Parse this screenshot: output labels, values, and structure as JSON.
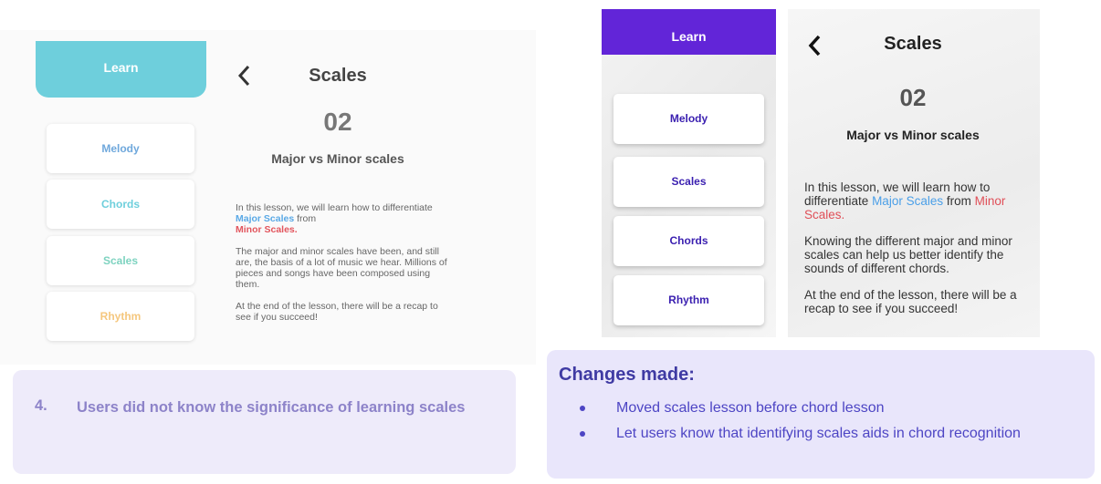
{
  "old_design": {
    "sidebar": {
      "learn_label": "Learn",
      "items": [
        {
          "label": "Melody",
          "color": "#6fa8dc"
        },
        {
          "label": "Chords",
          "color": "#6ecfdc"
        },
        {
          "label": "Scales",
          "color": "#7ed3c0"
        },
        {
          "label": "Rhythm",
          "color": "#f5c77e"
        }
      ]
    },
    "lesson": {
      "title": "Scales",
      "number": "02",
      "subtitle": "Major vs Minor scales",
      "intro_prefix": "In this lesson, we will learn how to differentiate",
      "major_scales": "Major Scales",
      "from": " from",
      "minor_scales": "Minor Scales",
      "period": ".",
      "paragraph2": "The major and minor scales have been, and still are, the basis of a lot of music we hear. Millions of pieces and songs have been composed using them.",
      "paragraph3": "At the end of the lesson, there will be a recap to see if you succeed!"
    },
    "issue": {
      "number": "4.",
      "text": "Users did not know the significance of learning scales"
    }
  },
  "new_design": {
    "sidebar": {
      "learn_label": "Learn",
      "items": [
        {
          "label": "Melody"
        },
        {
          "label": "Scales"
        },
        {
          "label": "Chords"
        },
        {
          "label": "Rhythm"
        }
      ]
    },
    "lesson": {
      "title": "Scales",
      "number": "02",
      "subtitle": "Major vs Minor scales",
      "intro_prefix": "In this lesson, we will learn how to differentiate ",
      "major_scales": "Major Scales",
      "from": " from ",
      "minor_scales": "Minor Scales",
      "period": ".",
      "paragraph2": "Knowing the different major and minor scales can help us better identify the sounds of different chords.",
      "paragraph3": "At the end of the lesson, there will be a recap to see if you succeed!"
    },
    "changes": {
      "title": "Changes made:",
      "items": [
        "Moved scales lesson before chord lesson",
        "Let users know that identifying scales aids in chord recognition"
      ]
    }
  },
  "colors": {
    "old_accent": "#6ecfdc",
    "new_accent": "#6225d8",
    "issue_text": "#8d83c9",
    "changes_text": "#4d45c4"
  }
}
